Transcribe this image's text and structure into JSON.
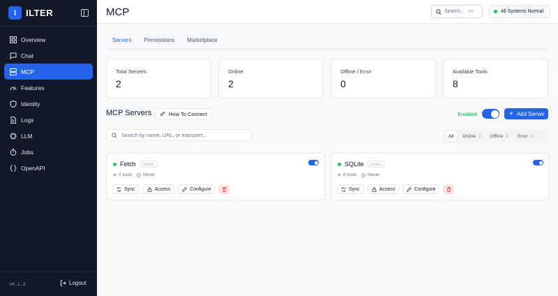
{
  "sidebar": {
    "logo_letter": "I",
    "brand": "ILTER",
    "items": [
      {
        "label": "Overview",
        "icon": "grid-icon"
      },
      {
        "label": "Chat",
        "icon": "chat-icon"
      },
      {
        "label": "MCP",
        "icon": "server-icon",
        "active": true
      },
      {
        "label": "Features",
        "icon": "gauge-icon"
      },
      {
        "label": "Identity",
        "icon": "shield-icon"
      },
      {
        "label": "Logs",
        "icon": "file-icon"
      },
      {
        "label": "LLM",
        "icon": "cpu-icon"
      },
      {
        "label": "Jobs",
        "icon": "timer-icon"
      },
      {
        "label": "OpenAPI",
        "icon": "braces-icon"
      }
    ],
    "version": "v0.1.2",
    "logout_label": "Logout"
  },
  "header": {
    "title": "MCP",
    "search_placeholder": "Search...",
    "search_shortcut": "⌘K",
    "status_text": "All Systems Normal",
    "status_color": "#22c55e"
  },
  "tabs": [
    "Servers",
    "Permissions",
    "Marketplace"
  ],
  "stats": [
    {
      "label": "Total Servers",
      "value": "2"
    },
    {
      "label": "Online",
      "value": "2"
    },
    {
      "label": "Offline / Error",
      "value": "0"
    },
    {
      "label": "Available Tools",
      "value": "8"
    }
  ],
  "servers_section": {
    "title": "MCP Servers",
    "how_to_label": "How To Connect",
    "enabled_label": "Enabled",
    "add_label": "Add Server",
    "search_placeholder": "Search by name, URL, or transport...",
    "filters": [
      {
        "label": "All",
        "count": ""
      },
      {
        "label": "Online",
        "count": "2"
      },
      {
        "label": "Offline",
        "count": "0"
      },
      {
        "label": "Error",
        "count": "0"
      }
    ]
  },
  "servers": [
    {
      "name": "Fetch",
      "transport": "STDIO",
      "tools": "0 tools",
      "last": "Never",
      "sync": "Sync",
      "access": "Access",
      "configure": "Configure",
      "enabled": true
    },
    {
      "name": "SQLite",
      "transport": "STDIO",
      "tools": "8 tools",
      "last": "Never",
      "sync": "Sync",
      "access": "Access",
      "configure": "Configure",
      "enabled": true
    }
  ],
  "colors": {
    "accent": "#2563eb",
    "sidebar_bg": "#111827",
    "success": "#22c55e",
    "danger_bg": "#fee2e2"
  }
}
